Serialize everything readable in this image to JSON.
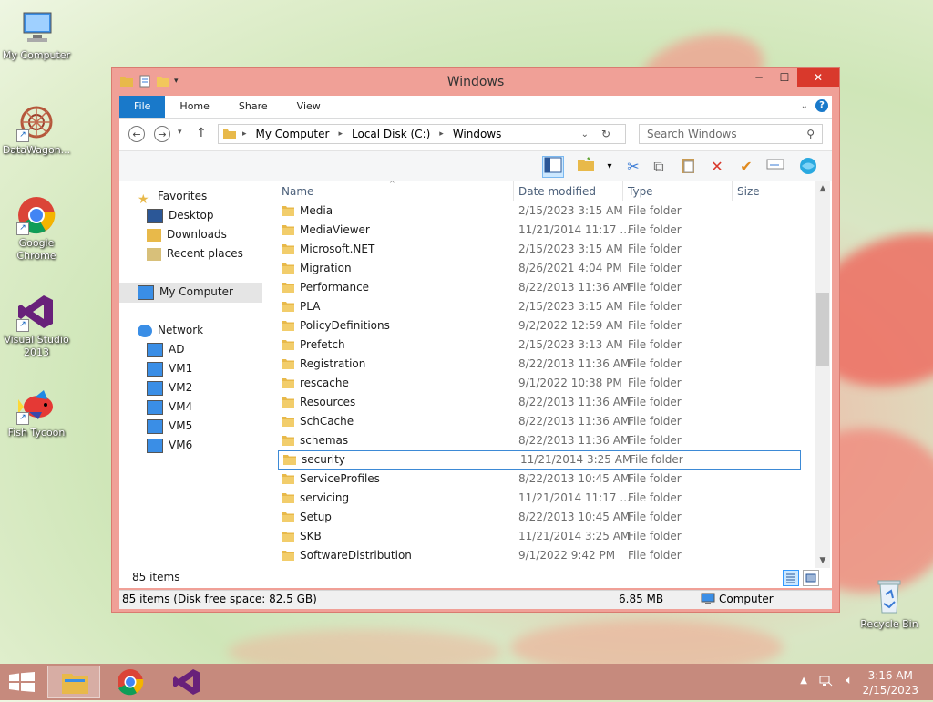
{
  "desktop": {
    "icons": [
      {
        "label": "My Computer"
      },
      {
        "label": "DataWagon..."
      },
      {
        "label": "Google Chrome"
      },
      {
        "label": "Visual Studio 2013"
      },
      {
        "label": "Fish Tycoon"
      },
      {
        "label": "Recycle Bin"
      }
    ]
  },
  "window": {
    "title": "Windows",
    "tabs": [
      {
        "label": "File"
      },
      {
        "label": "Home"
      },
      {
        "label": "Share"
      },
      {
        "label": "View"
      }
    ],
    "breadcrumb": [
      "My Computer",
      "Local Disk (C:)",
      "Windows"
    ],
    "search_placeholder": "Search Windows",
    "nav": {
      "favorites": "Favorites",
      "favorite_items": [
        "Desktop",
        "Downloads",
        "Recent places"
      ],
      "computer": "My Computer",
      "network": "Network",
      "network_items": [
        "AD",
        "VM1",
        "VM2",
        "VM4",
        "VM5",
        "VM6"
      ]
    },
    "columns": {
      "name": "Name",
      "date": "Date modified",
      "type": "Type",
      "size": "Size"
    },
    "files": [
      {
        "name": "Media",
        "date": "2/15/2023 3:15 AM",
        "type": "File folder"
      },
      {
        "name": "MediaViewer",
        "date": "11/21/2014 11:17 ...",
        "type": "File folder"
      },
      {
        "name": "Microsoft.NET",
        "date": "2/15/2023 3:15 AM",
        "type": "File folder"
      },
      {
        "name": "Migration",
        "date": "8/26/2021 4:04 PM",
        "type": "File folder"
      },
      {
        "name": "Performance",
        "date": "8/22/2013 11:36 AM",
        "type": "File folder"
      },
      {
        "name": "PLA",
        "date": "2/15/2023 3:15 AM",
        "type": "File folder"
      },
      {
        "name": "PolicyDefinitions",
        "date": "9/2/2022 12:59 AM",
        "type": "File folder"
      },
      {
        "name": "Prefetch",
        "date": "2/15/2023 3:13 AM",
        "type": "File folder"
      },
      {
        "name": "Registration",
        "date": "8/22/2013 11:36 AM",
        "type": "File folder"
      },
      {
        "name": "rescache",
        "date": "9/1/2022 10:38 PM",
        "type": "File folder"
      },
      {
        "name": "Resources",
        "date": "8/22/2013 11:36 AM",
        "type": "File folder"
      },
      {
        "name": "SchCache",
        "date": "8/22/2013 11:36 AM",
        "type": "File folder"
      },
      {
        "name": "schemas",
        "date": "8/22/2013 11:36 AM",
        "type": "File folder"
      },
      {
        "name": "security",
        "date": "11/21/2014 3:25 AM",
        "type": "File folder",
        "selected": true
      },
      {
        "name": "ServiceProfiles",
        "date": "8/22/2013 10:45 AM",
        "type": "File folder"
      },
      {
        "name": "servicing",
        "date": "11/21/2014 11:17 ...",
        "type": "File folder"
      },
      {
        "name": "Setup",
        "date": "8/22/2013 10:45 AM",
        "type": "File folder"
      },
      {
        "name": "SKB",
        "date": "11/21/2014 3:25 AM",
        "type": "File folder"
      },
      {
        "name": "SoftwareDistribution",
        "date": "9/1/2022 9:42 PM",
        "type": "File folder"
      }
    ],
    "item_count": "85 items",
    "status": {
      "left": "85 items (Disk free space: 82.5 GB)",
      "size": "6.85 MB",
      "location": "Computer"
    }
  },
  "taskbar": {
    "time": "3:16 AM",
    "date": "2/15/2023"
  },
  "colors": {
    "accent": "#1979ca",
    "close": "#d9392c",
    "frame": "#f0a097"
  }
}
